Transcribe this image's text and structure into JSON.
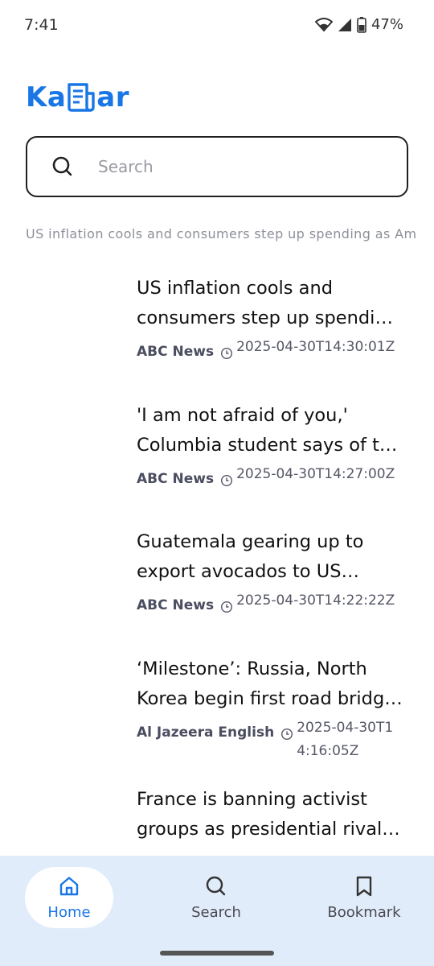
{
  "status_bar": {
    "time": "7:41",
    "battery": "47%"
  },
  "header": {
    "logo_text_left": "Ka",
    "logo_text_right": "ar",
    "accent_color": "#1976e6"
  },
  "search": {
    "placeholder": "Search",
    "value": ""
  },
  "ticker": {
    "text": "US inflation cools and consumers step up spending as Am"
  },
  "news": [
    {
      "title": "US inflation cools and consumers step up spending as Americans",
      "source": "ABC News",
      "time": "2025-04-30T14:30:01Z"
    },
    {
      "title": "'I am not afraid of you,' Columbia student says of the Trump administration",
      "source": "ABC News",
      "time": "2025-04-30T14:27:00Z"
    },
    {
      "title": "Guatemala gearing up to export avocados to US despite tariffs",
      "source": "ABC News",
      "time": "2025-04-30T14:22:22Z"
    },
    {
      "title": "‘Milestone’: Russia, North Korea begin first road bridge construction",
      "source": "Al Jazeera English",
      "time": "2025-04-30T14:16:05Z"
    },
    {
      "title": "France is banning activist groups as presidential rivals campaign",
      "source": "",
      "time": ""
    }
  ],
  "bottom_nav": {
    "items": [
      {
        "label": "Home",
        "icon": "home-icon",
        "active": true
      },
      {
        "label": "Search",
        "icon": "search-icon",
        "active": false
      },
      {
        "label": "Bookmark",
        "icon": "bookmark-icon",
        "active": false
      }
    ]
  }
}
